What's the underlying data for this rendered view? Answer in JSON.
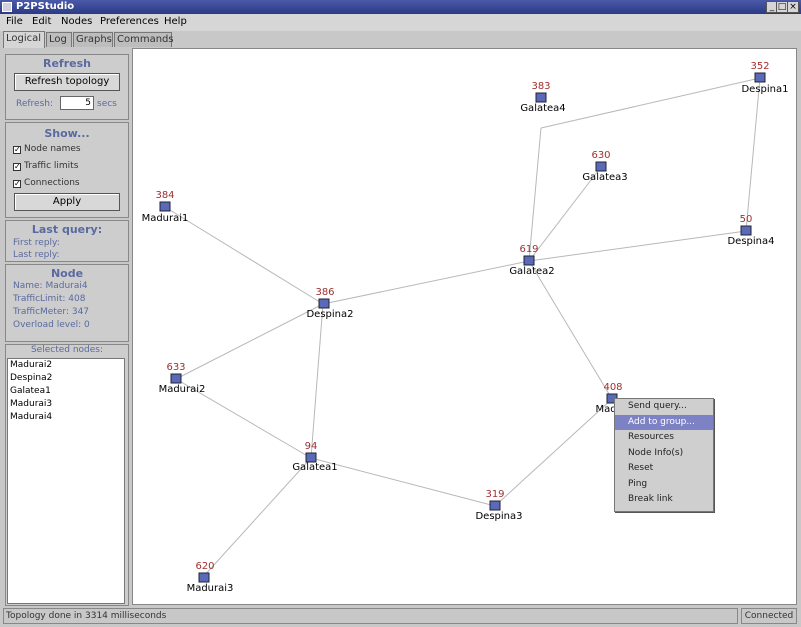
{
  "window": {
    "title": "P2PStudio",
    "controls": [
      "_",
      "□",
      "×"
    ]
  },
  "menu": [
    "File",
    "Edit",
    "Nodes",
    "Preferences",
    "Help"
  ],
  "tabs": [
    "Logical",
    "Log",
    "Graphs",
    "Commands"
  ],
  "refresh": {
    "title": "Refresh",
    "button": "Refresh topology",
    "label": "Refresh:",
    "value": "5",
    "unit": "secs"
  },
  "show": {
    "title": "Show...",
    "options": [
      "Node names",
      "Traffic limits",
      "Connections"
    ],
    "apply": "Apply"
  },
  "lastquery": {
    "title": "Last query:",
    "first": "First reply:",
    "last": "Last reply:"
  },
  "node": {
    "title": "Node",
    "name": "Name: Madurai4",
    "limit": "TrafficLimit: 408",
    "meter": "TrafficMeter: 347",
    "overload": "Overload level: 0"
  },
  "selected": {
    "title": "Selected nodes:",
    "items": [
      "Madurai2",
      "Despina2",
      "Galatea1",
      "Madurai3",
      "Madurai4"
    ]
  },
  "context_menu": [
    "Send query...",
    "Add to group...",
    "Resources",
    "Node Info(s)",
    "Reset",
    "Ping",
    "Break link"
  ],
  "status": {
    "message": "Topology done in 3314 milliseconds",
    "connection": "Connected"
  },
  "graph": {
    "nodes": [
      {
        "id": "Galatea4",
        "value": "383"
      },
      {
        "id": "Despina1",
        "value": "352"
      },
      {
        "id": "Galatea3",
        "value": "630"
      },
      {
        "id": "Madurai1",
        "value": "384"
      },
      {
        "id": "Despina4",
        "value": "50"
      },
      {
        "id": "Galatea2",
        "value": "619"
      },
      {
        "id": "Despina2",
        "value": "386"
      },
      {
        "id": "Madurai2",
        "value": "633"
      },
      {
        "id": "Madurai4",
        "value": "408",
        "name": "Mad"
      },
      {
        "id": "Galatea1",
        "value": "94"
      },
      {
        "id": "Despina3",
        "value": "319"
      },
      {
        "id": "Madurai3",
        "value": "620"
      }
    ]
  },
  "colors": {
    "value_text": "#a03030",
    "title_blue": "#5a6aa0",
    "menu_highlight": "#7c82c4"
  }
}
